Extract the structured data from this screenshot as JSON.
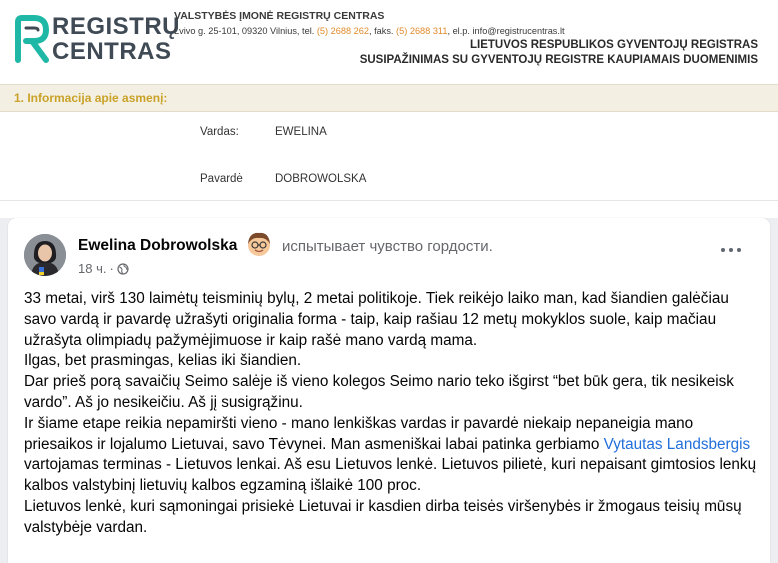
{
  "registry": {
    "logo": {
      "line1": "REGISTRŲ",
      "line2": "CENTRAS"
    },
    "org_name": "VALSTYBĖS ĮMONĖ REGISTRŲ CENTRAS",
    "address": {
      "part1": "Lvivo g. 25-101, 09320 Vilnius, tel.",
      "phone": "(5) 2688 262",
      "part2": ", faks.",
      "fax": "(5) 2688 311",
      "part3": ", el.p. info@registrucentras.lt"
    },
    "title": "LIETUVOS RESPUBLIKOS GYVENTOJŲ REGISTRAS",
    "subtitle": "SUSIPAŽINIMAS SU GYVENTOJŲ REGISTRE KAUPIAMAIS DUOMENIMIS",
    "section_title": "1. Informacija apie asmenį:",
    "fields": [
      {
        "label": "Vardas:",
        "value": "EWELINA"
      },
      {
        "label": "Pavardė",
        "value": "DOBROWOLSKA"
      }
    ],
    "colors": {
      "accent_orange": "#e08a2a",
      "section_gold": "#c9a227",
      "logo_teal": "#1fb8a6"
    }
  },
  "post": {
    "author": "Ewelina Dobrowolska",
    "feeling_text": "испытывает чувство гордости.",
    "time": "18 ч.",
    "separator": "·",
    "icons": {
      "feeling": "proud-face-emoji",
      "audience": "globe-icon",
      "menu": "more-options-icon"
    },
    "paragraphs": [
      "33 metai, virš 130 laimėtų teisminių bylų, 2 metai politikoje. Tiek reikėjo laiko man, kad šiandien galėčiau savo vardą ir pavardę užrašyti originalia forma - taip, kaip rašiau 12 metų mokyklos suole, kaip mačiau užrašyta olimpiadų pažymėjimuose ir kaip rašė mano vardą mama.",
      "Ilgas, bet prasmingas, kelias iki šiandien.",
      "Dar prieš porą savaičių Seimo salėje iš vieno kolegos Seimo nario teko išgirst “bet būk gera, tik nesikeisk vardo”. Aš jo nesikeičiu. Aš jį susigrąžinu."
    ],
    "paragraph4_part1": "Ir šiame etape reikia nepamiršti vieno - mano lenkiškas vardas ir pavardė niekaip nepaneigia mano priesaikos ir lojalumo Lietuvai, savo Tėvynei. Man asmeniškai labai patinka gerbiamo",
    "mention": "Vytautas Landsbergis",
    "paragraph4_part2": "vartojamas terminas - Lietuvos lenkai. Aš esu Lietuvos lenkė. Lietuvos pilietė, kuri nepaisant gimtosios lenkų kalbos valstybinį lietuvių kalbos egzaminą išlaikė 100 proc.",
    "paragraph5": "Lietuvos lenkė, kuri sąmoningai prisiekė Lietuvai ir kasdien dirba teisės viršenybės ir žmogaus teisių mūsų valstybėje vardan.",
    "colors": {
      "link": "#216fdb",
      "meta": "#65676b",
      "text": "#050505"
    }
  }
}
